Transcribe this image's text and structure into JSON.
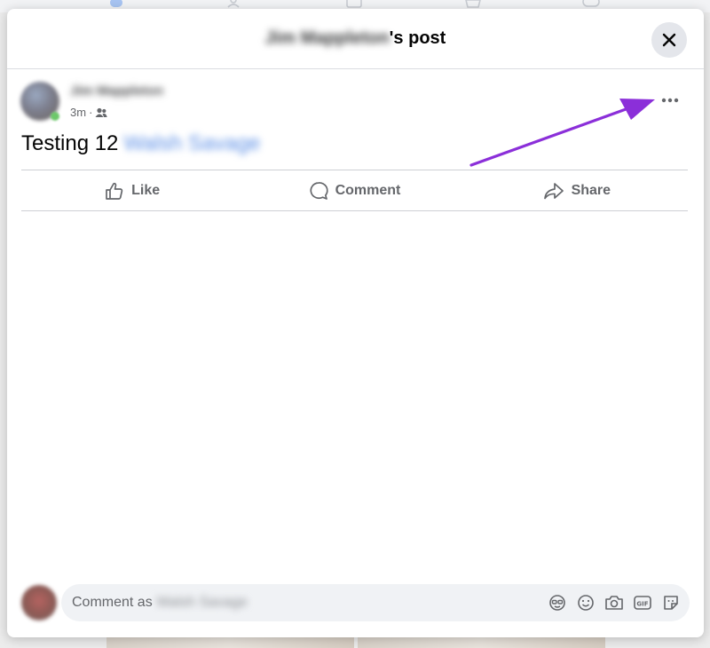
{
  "modal": {
    "title_name": "Jim Mappleton",
    "title_suffix": "'s post"
  },
  "post": {
    "author": "Jim Mappleton",
    "time": "3m",
    "separator": "·",
    "audience_icon": "friends-icon",
    "text": "Testing 12",
    "mention": "Walsh Savage"
  },
  "actions": {
    "like": "Like",
    "comment": "Comment",
    "share": "Share"
  },
  "comment_box": {
    "placeholder_prefix": "Comment as",
    "commenter_name": "Walsh Savage",
    "icons": [
      "avatar-sticker-icon",
      "emoji-icon",
      "camera-icon",
      "gif-icon",
      "sticker-icon"
    ]
  },
  "colors": {
    "annotation_arrow": "#8b2fd9",
    "mention": "#5b8ee6"
  }
}
